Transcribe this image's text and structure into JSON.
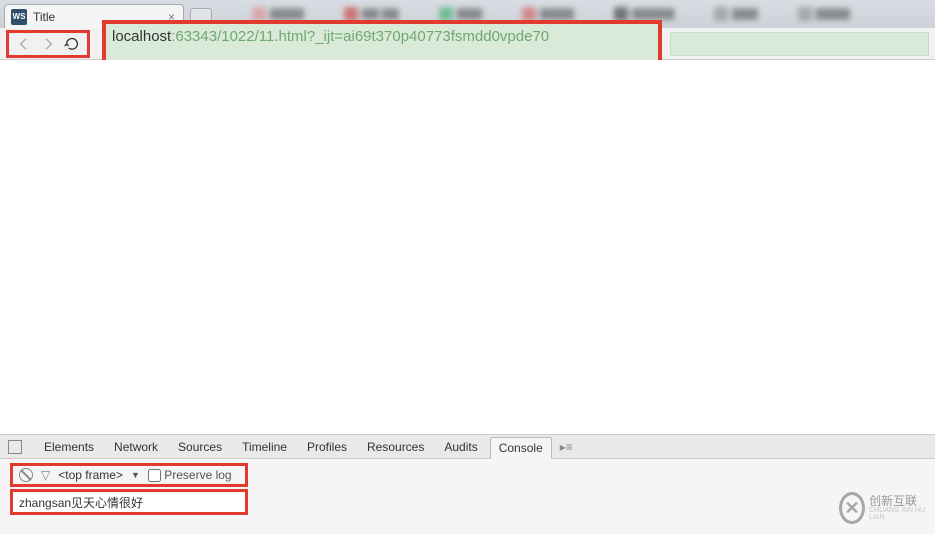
{
  "tab": {
    "favicon_label": "WS",
    "title": "Title",
    "close_glyph": "×"
  },
  "toolbar": {
    "back_tip": "Back",
    "forward_tip": "Forward",
    "reload_tip": "Reload"
  },
  "url": {
    "host": "localhost",
    "path": ":63343/1022/11.html?_ijt=ai69t370p40773fsmdd0vpde70"
  },
  "devtools": {
    "tabs": [
      "Elements",
      "Network",
      "Sources",
      "Timeline",
      "Profiles",
      "Resources",
      "Audits",
      "Console"
    ],
    "active_tab_index": 7,
    "drawer_glyph": "▸≡",
    "frame_selector": "<top frame>",
    "frame_dropdown_glyph": "▼",
    "preserve_log_label": "Preserve log",
    "filter_glyph": "▽",
    "console_output": "zhangsan见天心情很好"
  },
  "watermark": {
    "brand": "创新互联",
    "sub": "CHUANG XIN HU LIAN"
  }
}
